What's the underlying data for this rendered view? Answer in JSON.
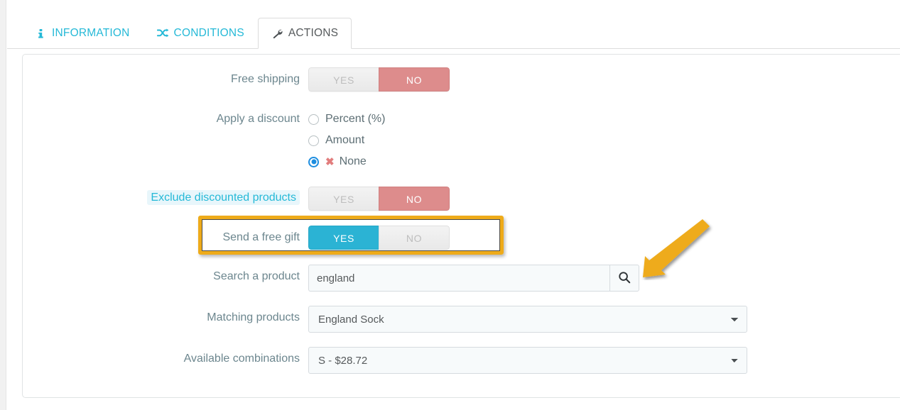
{
  "tabs": [
    {
      "label": "INFORMATION",
      "icon": "info-icon",
      "active": false
    },
    {
      "label": "CONDITIONS",
      "icon": "shuffle-icon",
      "active": false
    },
    {
      "label": "ACTIONS",
      "icon": "wrench-icon",
      "active": true
    }
  ],
  "colors": {
    "tab_link": "#25b9d7",
    "tab_active_text": "#565a5c",
    "switch_on_no": "#dd8c8c",
    "switch_on_yes": "#2bb3d4",
    "switch_off_text": "#bdbdbd",
    "radio_checked": "#1e8ee0",
    "x_mark": "#e27d7d",
    "highlight_border": "#eeab1a",
    "arrow": "#eeab1a",
    "label_text": "#6c868e",
    "link_label_bg": "#e8f6fb"
  },
  "form": {
    "free_shipping": {
      "label": "Free shipping",
      "yes": "YES",
      "no": "NO",
      "selected": "NO"
    },
    "apply_discount": {
      "label": "Apply a discount",
      "options": [
        {
          "label": "Percent (%)",
          "checked": false,
          "prefix": ""
        },
        {
          "label": "Amount",
          "checked": false,
          "prefix": ""
        },
        {
          "label": "None",
          "checked": true,
          "prefix": "✖"
        }
      ]
    },
    "exclude_discounted": {
      "label": "Exclude discounted products",
      "yes": "YES",
      "no": "NO",
      "selected": "NO"
    },
    "send_free_gift": {
      "label": "Send a free gift",
      "yes": "YES",
      "no": "NO",
      "selected": "YES",
      "highlighted": true
    },
    "search_product": {
      "label": "Search a product",
      "value": "england",
      "placeholder": "",
      "button_icon": "search-icon"
    },
    "matching_products": {
      "label": "Matching products",
      "value": "England Sock",
      "options": [
        "England Sock"
      ]
    },
    "available_combinations": {
      "label": "Available combinations",
      "value": "S - $28.72",
      "options": [
        "S - $28.72"
      ]
    }
  },
  "annotation": {
    "arrow": "arrow-pointing-down-left",
    "target": "search-product-button"
  }
}
